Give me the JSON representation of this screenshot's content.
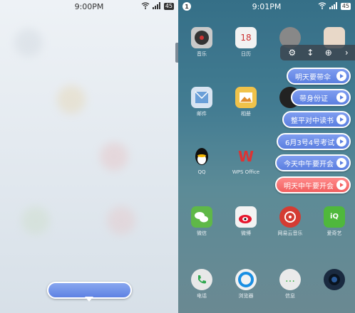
{
  "left": {
    "status": {
      "time": "9:00PM",
      "battery": "45"
    }
  },
  "right": {
    "status": {
      "time": "9:01PM",
      "battery": "45",
      "notif": "1"
    },
    "toolbar": [
      "⚙",
      "↕",
      "⊕",
      "›"
    ],
    "apps": [
      {
        "label": "音乐",
        "color": "#c9c9c9",
        "glyph": "♪",
        "name": "music-app"
      },
      {
        "label": "日历",
        "color": "#f2f2f2",
        "glyph": "18",
        "name": "calendar-app"
      },
      {
        "label": "邮件",
        "color": "#d8e4f2",
        "glyph": "✉",
        "name": "mail-app"
      },
      {
        "label": "相册",
        "color": "#f0c24a",
        "glyph": "▣",
        "name": "gallery-app"
      },
      {
        "label": "QQ",
        "color": "#2a2a2a",
        "glyph": "🐧",
        "name": "qq-app"
      },
      {
        "label": "WPS Office",
        "color": "#f4f4f4",
        "glyph": "W",
        "name": "wps-app"
      },
      {
        "label": "微信",
        "color": "#5fb848",
        "glyph": "✆",
        "name": "wechat-app"
      },
      {
        "label": "微博",
        "color": "#f3f3f3",
        "glyph": "◉",
        "name": "weibo-app"
      },
      {
        "label": "网易云音乐",
        "color": "#d43c33",
        "glyph": "◎",
        "name": "netease-music-app"
      },
      {
        "label": "爱奇艺",
        "color": "#4fb83c",
        "glyph": "iQ",
        "name": "iqiyi-app"
      },
      {
        "label": "电话",
        "color": "#e8e8e8",
        "glyph": "✆",
        "name": "phone-app"
      },
      {
        "label": "浏览器",
        "color": "#f2f2f2",
        "glyph": "C",
        "name": "browser-app"
      },
      {
        "label": "信息",
        "color": "#eaeaea",
        "glyph": "…",
        "name": "messages-app"
      },
      {
        "label": "",
        "color": "#1a2a40",
        "glyph": "◉",
        "name": "camera-app"
      }
    ],
    "chips": [
      {
        "text": "明天要带伞",
        "style": "blue"
      },
      {
        "text": "带身份证",
        "style": "blue"
      },
      {
        "text": "整平对中读书",
        "style": "blue"
      },
      {
        "text": "6月3号4号考试",
        "style": "blue"
      },
      {
        "text": "今天中午要开会",
        "style": "blue"
      },
      {
        "text": "明天中午要开会",
        "style": "red"
      }
    ]
  }
}
